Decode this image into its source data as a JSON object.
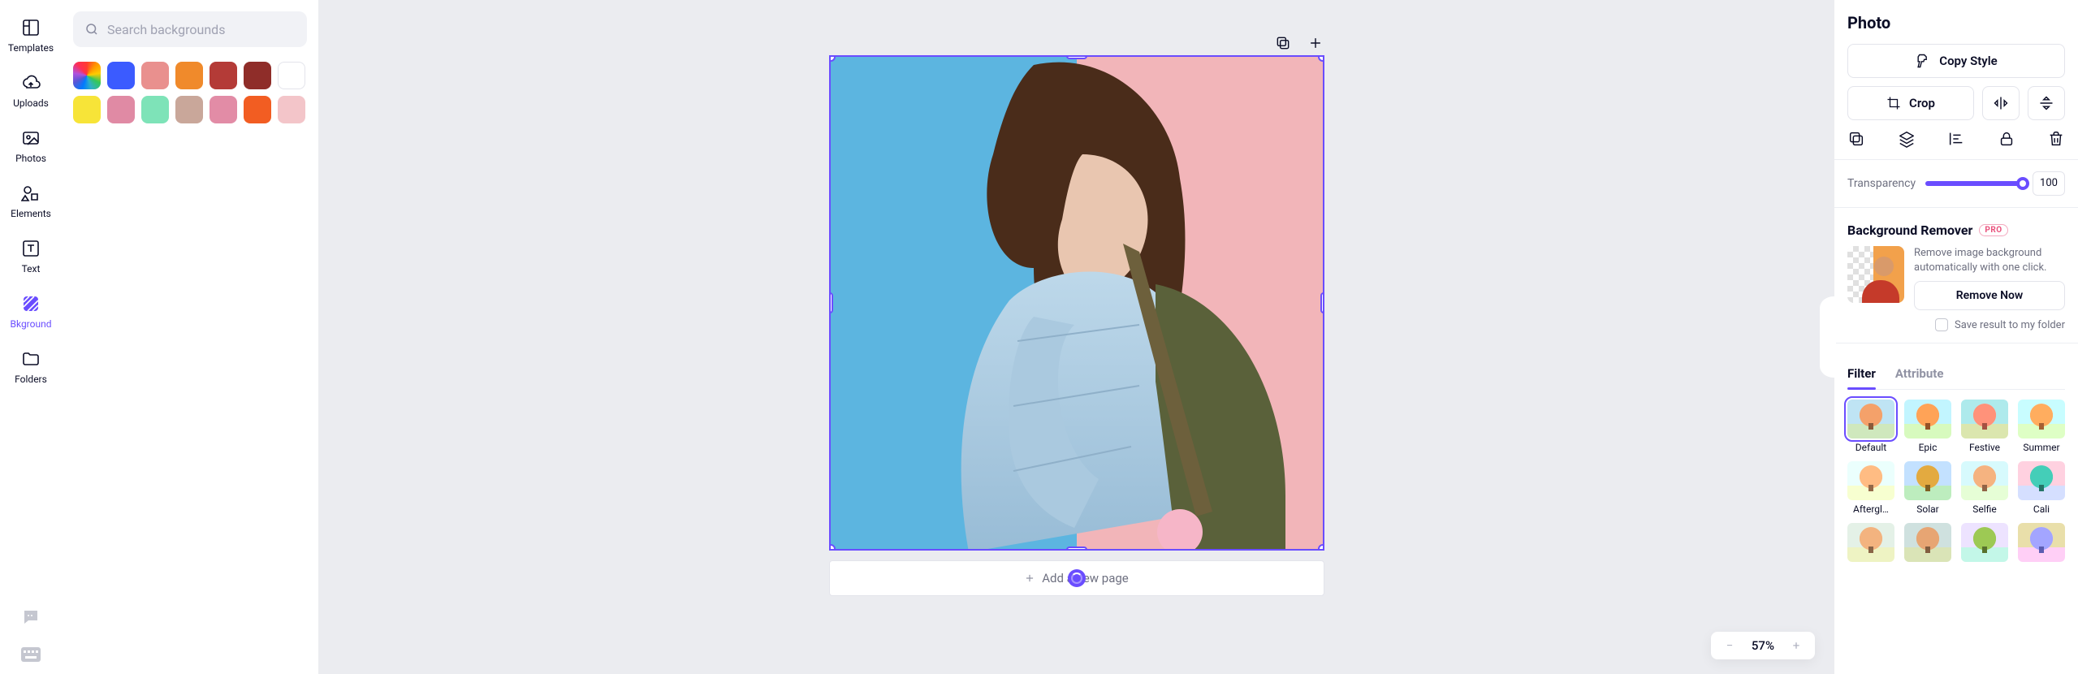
{
  "nav": {
    "items": [
      {
        "label": "Templates"
      },
      {
        "label": "Uploads"
      },
      {
        "label": "Photos"
      },
      {
        "label": "Elements"
      },
      {
        "label": "Text"
      },
      {
        "label": "Bkground"
      },
      {
        "label": "Folders"
      }
    ]
  },
  "panel": {
    "search_placeholder": "Search backgrounds",
    "colors": [
      "wheel",
      "#3b5bff",
      "#e9908e",
      "#f08a2b",
      "#b43b37",
      "#8f2d29",
      "white",
      "#f7e438",
      "#e08aa4",
      "#7ee3b8",
      "#c9a79a",
      "#e28ca6",
      "#f25d22",
      "#f3c5c9"
    ]
  },
  "canvas": {
    "add_page_label": "Add a new page",
    "zoom": {
      "value": "57%"
    }
  },
  "props": {
    "title": "Photo",
    "copy_style": "Copy Style",
    "crop": "Crop",
    "transparency_label": "Transparency",
    "transparency_value": "100",
    "bg_remover": {
      "title": "Background Remover",
      "pro": "PRO",
      "desc": "Remove image background automatically with one click.",
      "cta": "Remove Now",
      "save_label": "Save result to my folder"
    },
    "tabs": {
      "filter": "Filter",
      "attribute": "Attribute"
    },
    "filters": [
      {
        "label": "Default",
        "tint": "",
        "selected": true
      },
      {
        "label": "Epic",
        "tint": "tint-epic"
      },
      {
        "label": "Festive",
        "tint": "tint-festive"
      },
      {
        "label": "Summer",
        "tint": "tint-summer"
      },
      {
        "label": "Aftergl…",
        "tint": "tint-afterglow"
      },
      {
        "label": "Solar",
        "tint": "tint-solar"
      },
      {
        "label": "Selfie",
        "tint": "tint-selfie"
      },
      {
        "label": "Cali",
        "tint": "tint-cali"
      },
      {
        "label": "",
        "tint": "tint-row3a"
      },
      {
        "label": "",
        "tint": "tint-row3b"
      },
      {
        "label": "",
        "tint": "tint-row3c"
      },
      {
        "label": "",
        "tint": "tint-row3d"
      }
    ]
  }
}
